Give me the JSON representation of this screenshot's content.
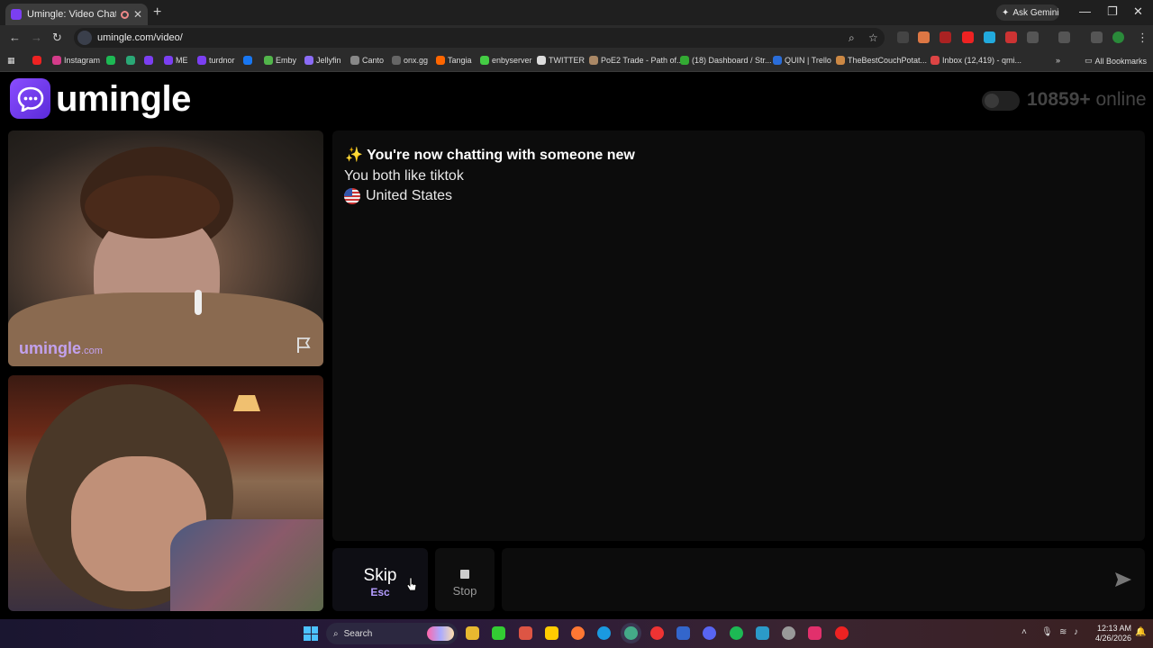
{
  "browser": {
    "tab_title": "Umingle: Video Chat with S",
    "new_tab": "+",
    "ask_gemini": "Ask Gemini",
    "url": "umingle.com/video/",
    "all_bookmarks": "All Bookmarks",
    "bookmarks": [
      {
        "label": "",
        "color": "#e22"
      },
      {
        "label": "Instagram",
        "color": "#d43c8a"
      },
      {
        "label": "",
        "color": "#1db954"
      },
      {
        "label": "",
        "color": "#2aa876"
      },
      {
        "label": "",
        "color": "#7b3ff2"
      },
      {
        "label": "ME",
        "color": "#7b3ff2"
      },
      {
        "label": "turdnor",
        "color": "#7b3ff2"
      },
      {
        "label": "",
        "color": "#1877f2"
      },
      {
        "label": "Emby",
        "color": "#52b54b"
      },
      {
        "label": "Jellyfin",
        "color": "#8b6cf6"
      },
      {
        "label": "Canto",
        "color": "#888"
      },
      {
        "label": "onx.gg",
        "color": "#666"
      },
      {
        "label": "Tangia",
        "color": "#f60"
      },
      {
        "label": "enbyserver",
        "color": "#4c4"
      },
      {
        "label": "TWITTER",
        "color": "#ddd"
      },
      {
        "label": "PoE2 Trade - Path of...",
        "color": "#a86"
      },
      {
        "label": "(18) Dashboard / Str...",
        "color": "#3a3"
      },
      {
        "label": "QUIN | Trello",
        "color": "#2a6dd9"
      },
      {
        "label": "TheBestCouchPotat...",
        "color": "#c84"
      },
      {
        "label": "Inbox (12,419) - qmi...",
        "color": "#d44"
      }
    ]
  },
  "page": {
    "logo_text": "umingle",
    "online_count": "10859+",
    "online_label": " online",
    "watermark_main": "umingle",
    "watermark_suffix": ".com"
  },
  "chat": {
    "header": "✨ You're now chatting with someone new",
    "interest": "You both like tiktok",
    "country": "United States"
  },
  "controls": {
    "skip_label": "Skip",
    "skip_key": "Esc",
    "stop_label": "Stop",
    "message_placeholder": ""
  },
  "taskbar": {
    "search_label": "Search",
    "time": "12:13 AM",
    "date": "4/26/2026"
  },
  "colors": {
    "brand": "#7b3ff2",
    "accent_key": "#b49cff"
  }
}
